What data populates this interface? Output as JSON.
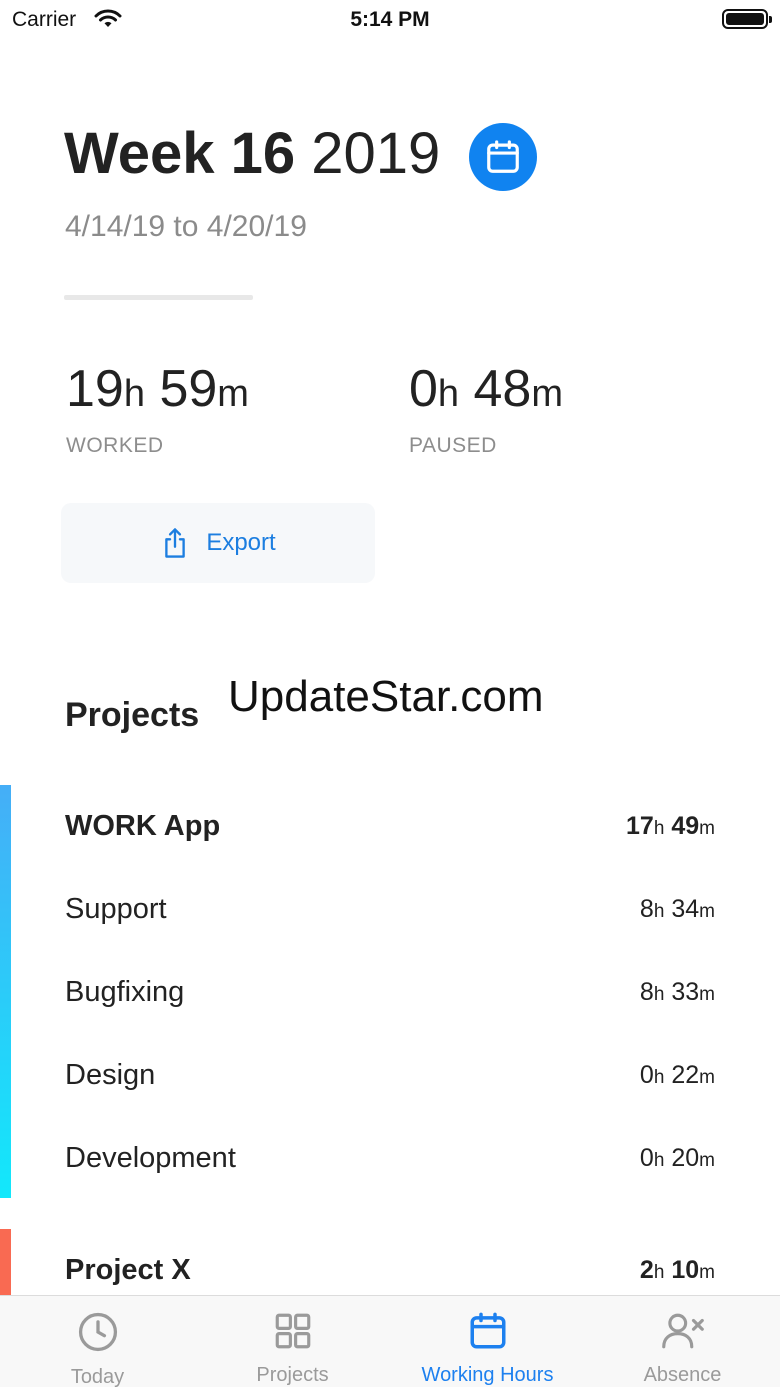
{
  "status_bar": {
    "carrier": "Carrier",
    "time": "5:14 PM"
  },
  "header": {
    "week_label": "Week 16",
    "year": "2019",
    "date_range": "4/14/19 to 4/20/19",
    "calendar_icon": "calendar-icon",
    "accent_color": "#1083f0"
  },
  "stats": {
    "worked": {
      "hours": "19",
      "minutes": "59",
      "label": "WORKED"
    },
    "paused": {
      "hours": "0",
      "minutes": "48",
      "label": "PAUSED"
    },
    "hours_unit": "h",
    "minutes_unit": "m"
  },
  "export": {
    "label": "Export",
    "icon": "share-icon"
  },
  "projects": {
    "title": "Projects",
    "watermark": "UpdateStar.com",
    "groups": [
      {
        "name": "WORK App",
        "hours": "17",
        "minutes": "49",
        "color": "#45aef7",
        "tasks": [
          {
            "name": "Support",
            "hours": "8",
            "minutes": "34"
          },
          {
            "name": "Bugfixing",
            "hours": "8",
            "minutes": "33"
          },
          {
            "name": "Design",
            "hours": "0",
            "minutes": "22"
          },
          {
            "name": "Development",
            "hours": "0",
            "minutes": "20"
          }
        ]
      },
      {
        "name": "Project X",
        "hours": "2",
        "minutes": "10",
        "color": "#f96a52",
        "tasks": []
      }
    ]
  },
  "tab_bar": {
    "active_color": "#1d80ef",
    "tabs": [
      {
        "label": "Today",
        "icon": "clock-icon",
        "active": false
      },
      {
        "label": "Projects",
        "icon": "grid-icon",
        "active": false
      },
      {
        "label": "Working Hours",
        "icon": "calendar-icon",
        "active": true
      },
      {
        "label": "Absence",
        "icon": "person-x-icon",
        "active": false
      }
    ]
  }
}
